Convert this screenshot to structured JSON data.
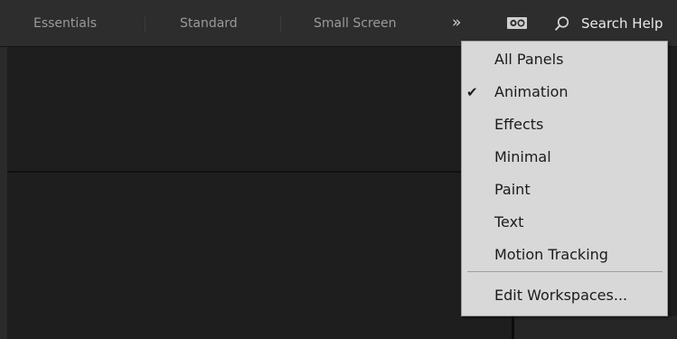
{
  "workspace_bar": {
    "tabs": [
      {
        "label": "Essentials"
      },
      {
        "label": "Standard"
      },
      {
        "label": "Small Screen"
      }
    ],
    "overflow_label": "»",
    "workspace_icon": "workspace-settings-icon",
    "search_icon": "search-icon",
    "search_placeholder": "Search Help"
  },
  "menu": {
    "items": [
      {
        "label": "All Panels",
        "checked": false
      },
      {
        "label": "Animation",
        "checked": true
      },
      {
        "label": "Effects",
        "checked": false
      },
      {
        "label": "Minimal",
        "checked": false
      },
      {
        "label": "Paint",
        "checked": false
      },
      {
        "label": "Text",
        "checked": false
      },
      {
        "label": "Motion Tracking",
        "checked": false
      }
    ],
    "check_mark": "✔",
    "footer_item": {
      "label": "Edit Workspaces..."
    }
  },
  "colors": {
    "menu_background": "#d8d8d8",
    "menu_text": "#1b1b1b",
    "bar_background": "#2d2d2d",
    "panel_background": "#1e1e1e"
  }
}
